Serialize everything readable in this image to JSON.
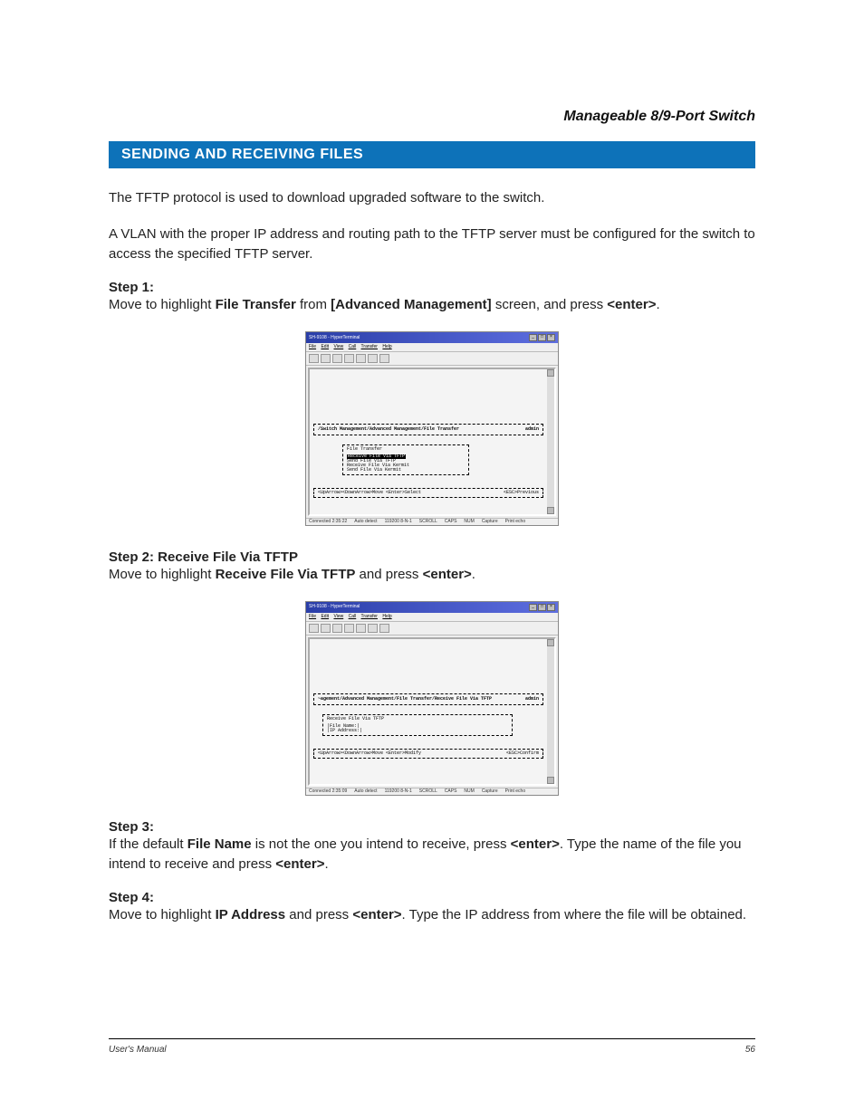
{
  "header": {
    "title": "Manageable 8/9-Port Switch"
  },
  "section": {
    "title": "SENDING AND RECEIVING FILES"
  },
  "paragraphs": {
    "p1": "The TFTP protocol is used to download upgraded software to the switch.",
    "p2": "A VLAN with the proper IP address and routing path to the TFTP server must be configured for the switch to access the specified TFTP server."
  },
  "steps": {
    "s1": {
      "heading": "Step 1:",
      "pre": "Move to highlight ",
      "bold1": "File Transfer",
      "mid1": " from ",
      "bold2": "[Advanced Management]",
      "mid2": " screen, and press ",
      "bold3": "<enter>",
      "post": "."
    },
    "s2": {
      "heading": "Step 2: Receive File Via TFTP",
      "pre": "Move to highlight ",
      "bold1": "Receive File Via TFTP",
      "mid": " and press ",
      "bold2": "<enter>",
      "post": "."
    },
    "s3": {
      "heading": "Step 3:",
      "pre": "If the default ",
      "bold1": "File Name",
      "mid1": " is not the one you intend to receive, press ",
      "bold2": "<enter>",
      "mid2": ". Type the name of the file you intend to receive and press ",
      "bold3": "<enter>",
      "post": "."
    },
    "s4": {
      "heading": "Step 4:",
      "pre": "Move to highlight ",
      "bold1": "IP Address",
      "mid1": " and press ",
      "bold2": "<enter>",
      "mid2": ". Type the IP address from where the file will be obtained.",
      "post": ""
    }
  },
  "figure1": {
    "window_title": "SH-9108 - HyperTerminal",
    "menu": {
      "file": "File",
      "edit": "Edit",
      "view": "View",
      "call": "Call",
      "transfer": "Transfer",
      "help": "Help"
    },
    "breadcrumb": "/Switch Management/Advanced Management/File Transfer",
    "admin": "admin",
    "box_title": "File Transfer",
    "items": {
      "i1": "Receive File Via TFTP",
      "i2": "Send File Via TFTP",
      "i3": "Receive File Via Kermit",
      "i4": "Send File Via Kermit"
    },
    "hints_left": "<UpArrow><DownArrow>Move  <Enter>Select",
    "hints_right": "<ESC>Previous",
    "status": {
      "a": "Connected 2:35:22",
      "b": "Auto detect",
      "c": "119200 8-N-1",
      "d": "SCROLL",
      "e": "CAPS",
      "f": "NUM",
      "g": "Capture",
      "h": "Print echo"
    }
  },
  "figure2": {
    "window_title": "SH-9108 - HyperTerminal",
    "menu": {
      "file": "File",
      "edit": "Edit",
      "view": "View",
      "call": "Call",
      "transfer": "Transfer",
      "help": "Help"
    },
    "breadcrumb": "~agement/Advanced Management/File Transfer/Receive File Via TFTP",
    "admin": "admin",
    "box_title": "Receive File Via TFTP",
    "fields": {
      "f1_label": "|File Name:|",
      "f2_label": "|IP Address:|"
    },
    "hints_left": "<UpArrow><DownArrow>Move  <Enter>Modify",
    "hints_right": "<ESC>Confirm",
    "status": {
      "a": "Connected 2:35:09",
      "b": "Auto detect",
      "c": "119200 8-N-1",
      "d": "SCROLL",
      "e": "CAPS",
      "f": "NUM",
      "g": "Capture",
      "h": "Print echo"
    }
  },
  "footer": {
    "left": "User's Manual",
    "right": "56"
  }
}
